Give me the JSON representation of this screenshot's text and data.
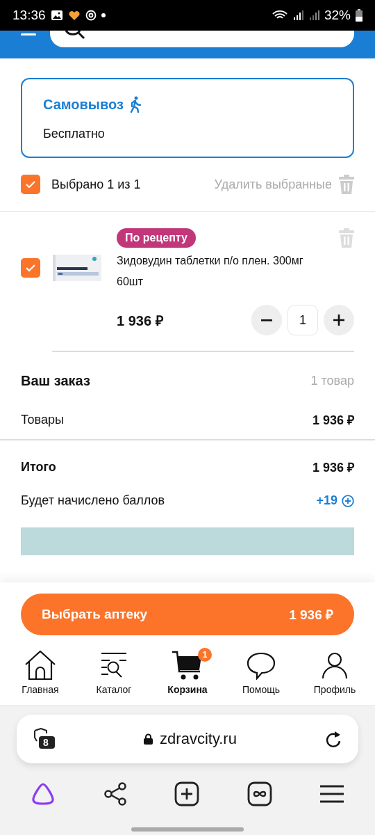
{
  "status_bar": {
    "time": "13:36",
    "battery": "32%"
  },
  "pickup": {
    "title": "Самовывоз",
    "subtitle": "Бесплатно",
    "selected": true
  },
  "selection": {
    "checked": true,
    "label": "Выбрано 1 из 1",
    "delete_label": "Удалить выбранные"
  },
  "cart_items": [
    {
      "checked": true,
      "badge": "По рецепту",
      "name": "Зидовудин таблетки п/о плен. 300мг 60шт",
      "price": "1 936 ₽",
      "quantity": "1",
      "kind": "picture"
    }
  ],
  "order": {
    "title": "Ваш заказ",
    "count": "1 товар",
    "rows": [
      {
        "label": "Товары",
        "value": "1 936 ₽"
      }
    ]
  },
  "total": {
    "label": "Итого",
    "value": "1 936 ₽"
  },
  "points": {
    "label": "Будет начислено баллов",
    "value": "+19"
  },
  "checkout_button": {
    "label": "Выбрать аптеку",
    "price": "1 936 ₽"
  },
  "bottom_nav": [
    {
      "label": "Главная",
      "kind": "home",
      "selected": false
    },
    {
      "label": "Каталог",
      "kind": "catalog",
      "selected": false
    },
    {
      "label": "Корзина",
      "kind": "cart",
      "selected": true,
      "badge": "1"
    },
    {
      "label": "Помощь",
      "kind": "help",
      "selected": false
    },
    {
      "label": "Профиль",
      "kind": "profile",
      "selected": false
    }
  ],
  "browser": {
    "tab_count": "8",
    "url": "zdravcity.ru"
  }
}
